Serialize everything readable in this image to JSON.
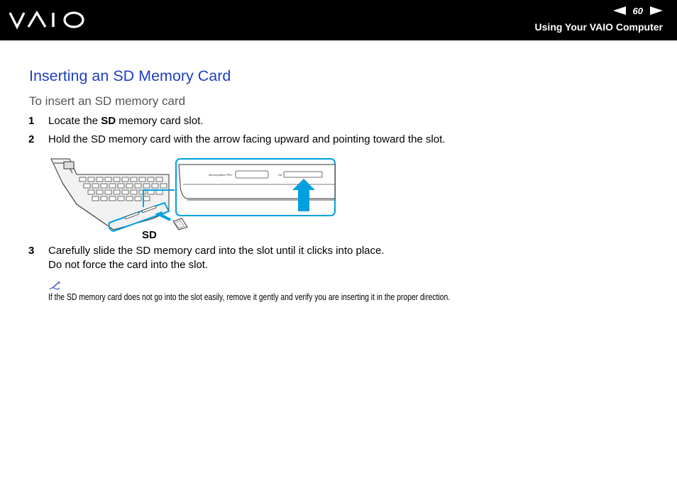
{
  "header": {
    "logo_text": "VAIO",
    "page_number": "60",
    "section_title": "Using Your VAIO Computer",
    "prev_icon": "triangle-left-icon",
    "next_icon": "triangle-right-icon",
    "colors": {
      "background": "#000000",
      "text": "#ffffff"
    }
  },
  "content": {
    "title": "Inserting an SD Memory Card",
    "subtitle": "To insert an SD memory card",
    "steps": [
      {
        "num": "1",
        "pre": "Locate the ",
        "bold": "SD",
        "post": " memory card slot."
      },
      {
        "num": "2",
        "text": "Hold the SD memory card with the arrow facing upward and pointing toward the slot."
      },
      {
        "num": "3",
        "line1": "Carefully slide the SD memory card into the slot until it clicks into place.",
        "line2": "Do not force the card into the slot."
      }
    ],
    "figure": {
      "sd_label": "SD",
      "slot_labels": {
        "memory_stick": "MemoryStick PRO",
        "sd": "SD"
      },
      "accent_color": "#00a0e0",
      "arrow_color": "#00a0e0"
    },
    "note": {
      "icon": "pencil-note-icon",
      "text": "If the SD memory card does not go into the slot easily, remove it gently and verify you are inserting it in the proper direction."
    },
    "colors": {
      "title": "#1f3fbf",
      "subtitle": "#555555"
    }
  }
}
